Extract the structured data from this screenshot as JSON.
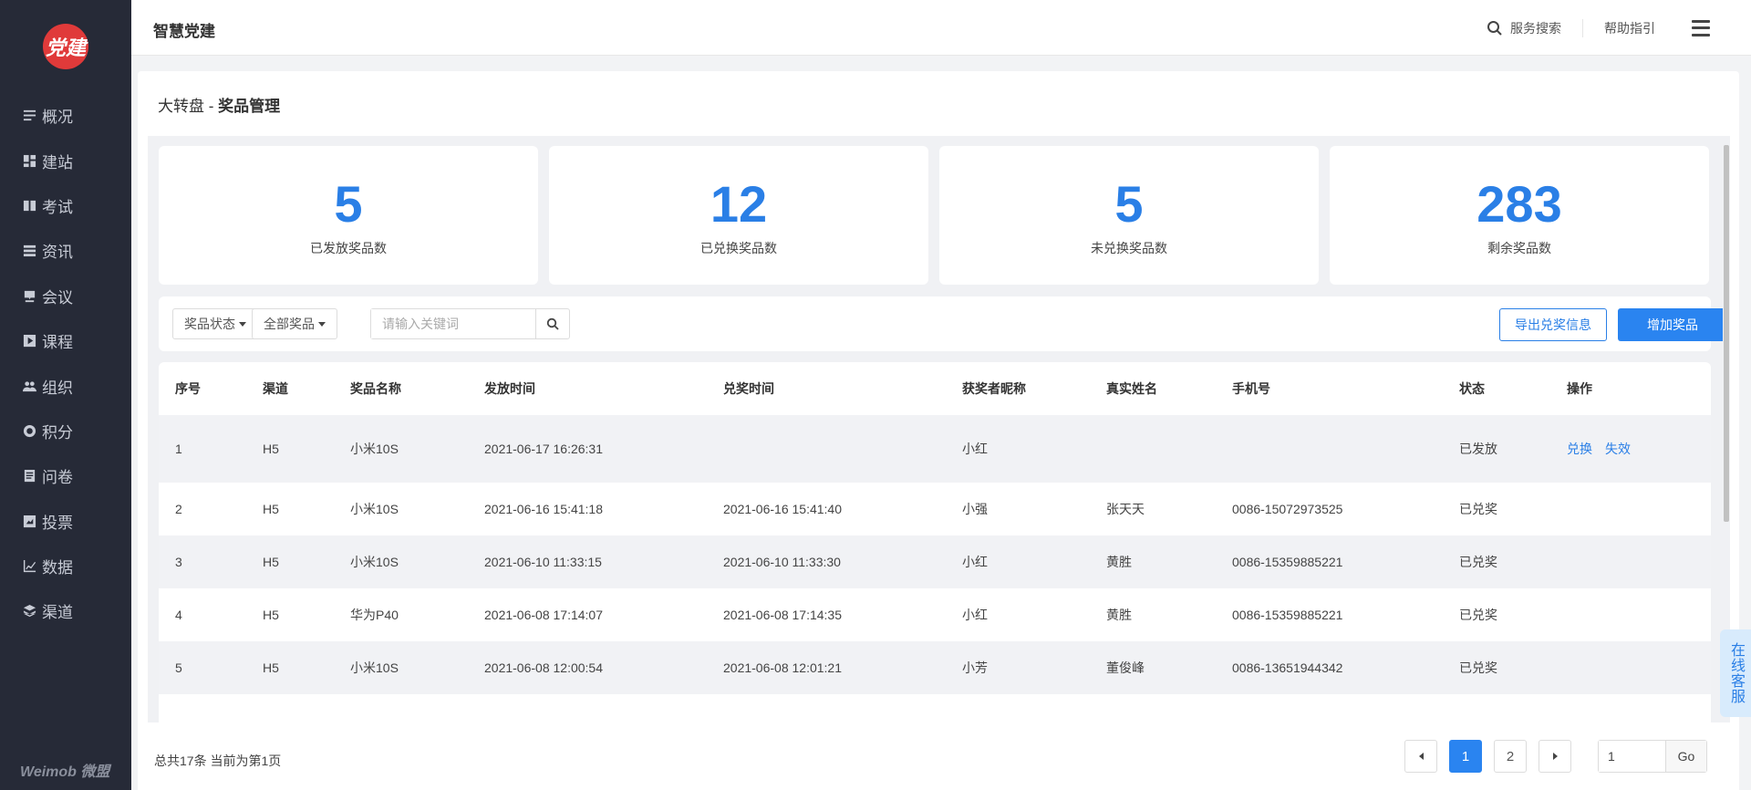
{
  "sidebar": {
    "logo_text": "党建",
    "brand": "Weimob 微盟",
    "items": [
      {
        "label": "概况",
        "icon": "list-icon"
      },
      {
        "label": "建站",
        "icon": "dashboard-icon"
      },
      {
        "label": "考试",
        "icon": "book-icon"
      },
      {
        "label": "资讯",
        "icon": "news-icon"
      },
      {
        "label": "会议",
        "icon": "meeting-icon"
      },
      {
        "label": "课程",
        "icon": "play-icon"
      },
      {
        "label": "组织",
        "icon": "group-icon"
      },
      {
        "label": "积分",
        "icon": "coin-icon"
      },
      {
        "label": "问卷",
        "icon": "form-icon"
      },
      {
        "label": "投票",
        "icon": "vote-icon"
      },
      {
        "label": "数据",
        "icon": "chart-icon"
      },
      {
        "label": "渠道",
        "icon": "layers-icon"
      }
    ]
  },
  "header": {
    "title": "智慧党建",
    "search_label": "服务搜索",
    "help_label": "帮助指引"
  },
  "breadcrumb": {
    "parent": "大转盘 - ",
    "current": "奖品管理"
  },
  "stats": [
    {
      "value": "5",
      "label": "已发放奖品数"
    },
    {
      "value": "12",
      "label": "已兑换奖品数"
    },
    {
      "value": "5",
      "label": "未兑换奖品数"
    },
    {
      "value": "283",
      "label": "剩余奖品数"
    }
  ],
  "toolbar": {
    "status_filter": "奖品状态",
    "prize_filter": "全部奖品",
    "search_placeholder": "请输入关键词",
    "export_label": "导出兑奖信息",
    "add_label": "增加奖品"
  },
  "table": {
    "headers": [
      "序号",
      "渠道",
      "奖品名称",
      "发放时间",
      "兑奖时间",
      "获奖者昵称",
      "真实姓名",
      "手机号",
      "状态",
      "操作"
    ],
    "rows": [
      {
        "no": "1",
        "channel": "H5",
        "prize": "小米10S",
        "issued": "2021-06-17 16:26:31",
        "redeemed": "",
        "nickname": "小红",
        "name": "",
        "phone": "",
        "status": "已发放",
        "actions": [
          "兑换",
          "失效"
        ]
      },
      {
        "no": "2",
        "channel": "H5",
        "prize": "小米10S",
        "issued": "2021-06-16 15:41:18",
        "redeemed": "2021-06-16 15:41:40",
        "nickname": "小强",
        "name": "张天天",
        "phone": "0086-15072973525",
        "status": "已兑奖",
        "actions": []
      },
      {
        "no": "3",
        "channel": "H5",
        "prize": "小米10S",
        "issued": "2021-06-10 11:33:15",
        "redeemed": "2021-06-10 11:33:30",
        "nickname": "小红",
        "name": "黄胜",
        "phone": "0086-15359885221",
        "status": "已兑奖",
        "actions": []
      },
      {
        "no": "4",
        "channel": "H5",
        "prize": "华为P40",
        "issued": "2021-06-08 17:14:07",
        "redeemed": "2021-06-08 17:14:35",
        "nickname": "小红",
        "name": "黄胜",
        "phone": "0086-15359885221",
        "status": "已兑奖",
        "actions": []
      },
      {
        "no": "5",
        "channel": "H5",
        "prize": "小米10S",
        "issued": "2021-06-08 12:00:54",
        "redeemed": "2021-06-08 12:01:21",
        "nickname": "小芳",
        "name": "董俊峰",
        "phone": "0086-13651944342",
        "status": "已兑奖",
        "actions": []
      }
    ]
  },
  "pagination": {
    "summary": "总共17条 当前为第1页",
    "pages": [
      "1",
      "2"
    ],
    "current": "1",
    "goto_value": "1",
    "go_label": "Go"
  },
  "chat": {
    "label": "在线客服"
  }
}
